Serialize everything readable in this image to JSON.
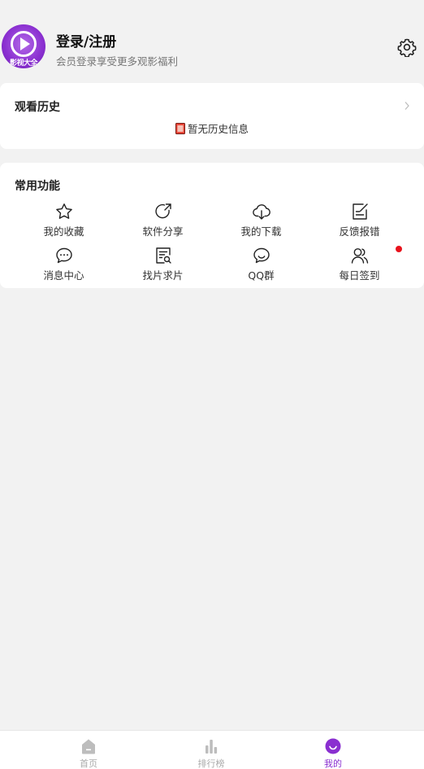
{
  "profile": {
    "avatar_text": "影视大全",
    "title": "登录/注册",
    "subtitle": "会员登录享受更多观影福利"
  },
  "history": {
    "title": "观看历史",
    "empty_text": "暂无历史信息"
  },
  "functions": {
    "title": "常用功能",
    "items": [
      {
        "label": "我的收藏",
        "icon": "star-icon"
      },
      {
        "label": "软件分享",
        "icon": "share-icon"
      },
      {
        "label": "我的下载",
        "icon": "cloud-download-icon"
      },
      {
        "label": "反馈报错",
        "icon": "feedback-icon"
      },
      {
        "label": "消息中心",
        "icon": "message-icon"
      },
      {
        "label": "找片求片",
        "icon": "search-document-icon"
      },
      {
        "label": "QQ群",
        "icon": "chat-icon"
      },
      {
        "label": "每日签到",
        "icon": "users-icon",
        "badge": true
      }
    ]
  },
  "tabbar": {
    "items": [
      {
        "label": "首页",
        "icon": "home-icon",
        "active": false
      },
      {
        "label": "排行榜",
        "icon": "bar-chart-icon",
        "active": false
      },
      {
        "label": "我的",
        "icon": "smile-icon",
        "active": true
      }
    ]
  },
  "colors": {
    "accent": "#8a2fd0",
    "badge": "#e8121c",
    "background": "#f2f2f2",
    "inactive_tab": "#aaaaaa"
  }
}
